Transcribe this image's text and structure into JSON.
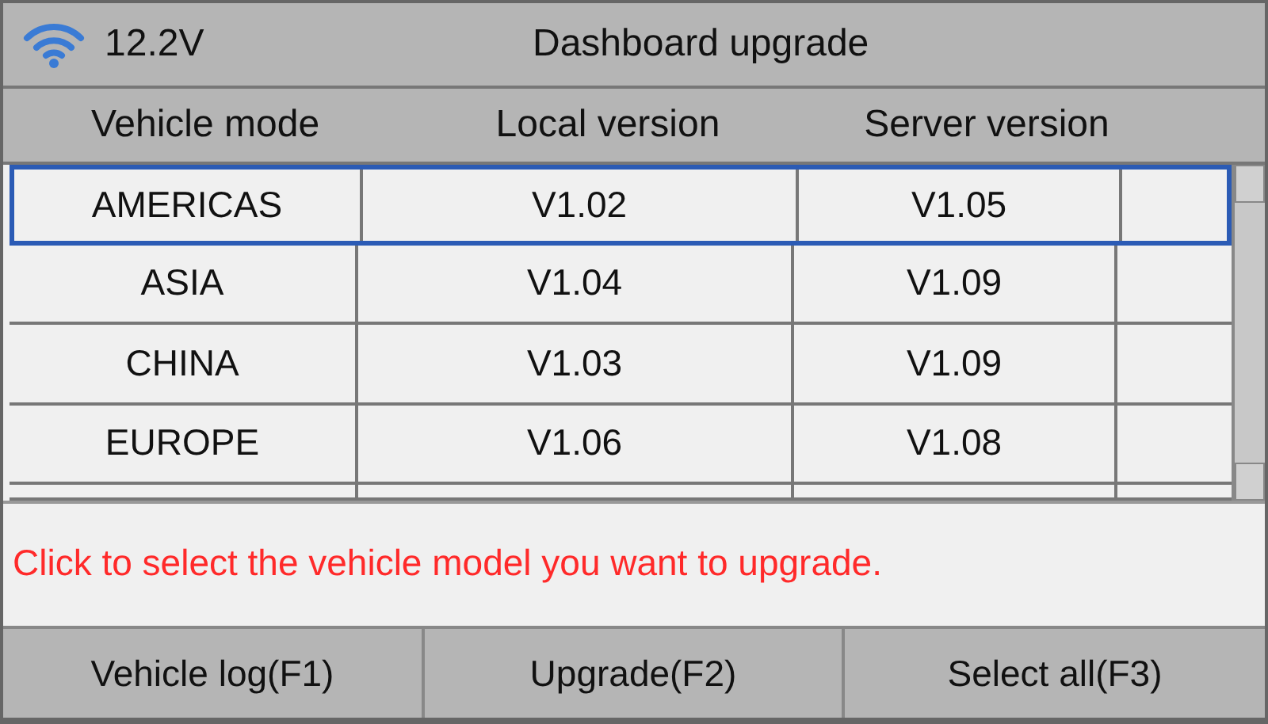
{
  "status_bar": {
    "voltage": "12.2V",
    "title": "Dashboard upgrade"
  },
  "table": {
    "columns": [
      "Vehicle mode",
      "Local version",
      "Server version"
    ],
    "rows": [
      {
        "cells": [
          "AMERICAS",
          "V1.02",
          "V1.05"
        ],
        "selected": true
      },
      {
        "cells": [
          "ASIA",
          "V1.04",
          "V1.09"
        ],
        "selected": false
      },
      {
        "cells": [
          "CHINA",
          "V1.03",
          "V1.09"
        ],
        "selected": false
      },
      {
        "cells": [
          "EUROPE",
          "V1.06",
          "V1.08"
        ],
        "selected": false
      }
    ]
  },
  "message": "Click to select the vehicle model you want to upgrade.",
  "buttons": [
    "Vehicle log(F1)",
    "Upgrade(F2)",
    "Select all(F3)"
  ]
}
